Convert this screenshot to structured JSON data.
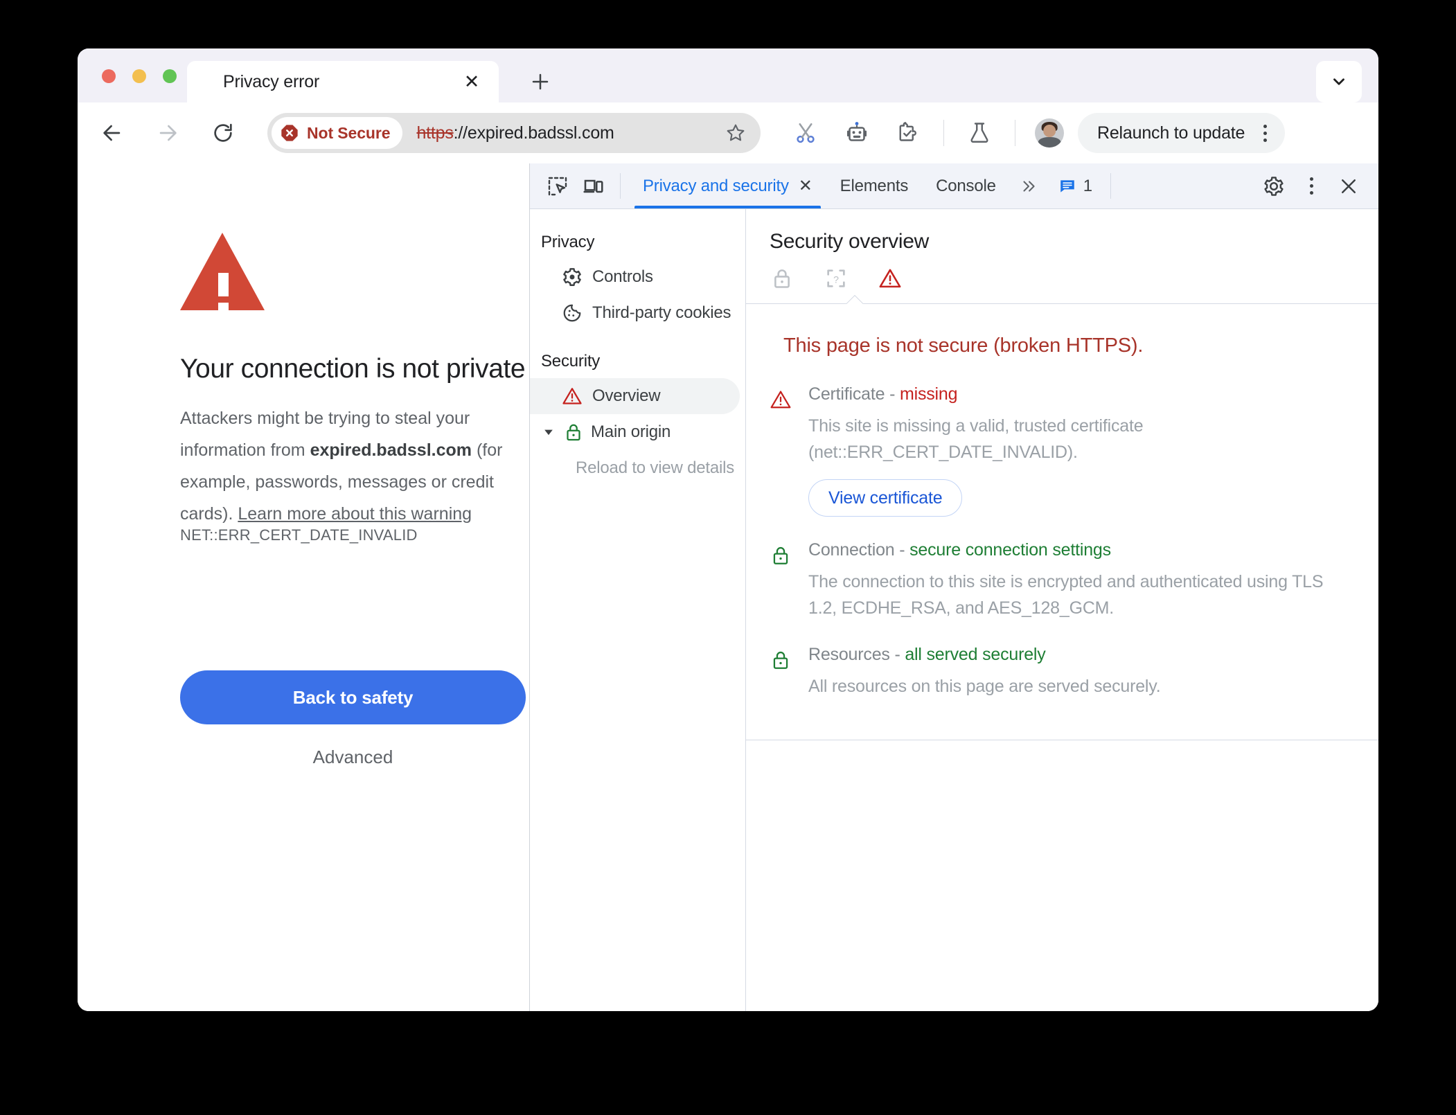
{
  "window": {
    "chevron_icon": "chevron-down-icon"
  },
  "tabstrip": {
    "tab_title": "Privacy error",
    "close_icon": "close-icon",
    "new_tab_icon": "plus-icon"
  },
  "toolbar": {
    "back_icon": "arrow-left-icon",
    "forward_icon": "arrow-right-icon",
    "reload_icon": "reload-icon",
    "security_badge": "Not Secure",
    "security_badge_icon": "not-secure-octagon-icon",
    "url_scheme": "https",
    "url_rest": "://expired.badssl.com",
    "bookmark_icon": "star-icon",
    "extension_icons": [
      "scissors-icon",
      "robot-icon",
      "puzzle-extension-icon",
      "flask-experiments-icon"
    ],
    "avatar_icon": "profile-avatar",
    "relaunch_label": "Relaunch to update",
    "menu_icon": "kebab-menu-icon"
  },
  "page": {
    "warning_icon": "warning-triangle-icon",
    "heading": "Your connection is not private",
    "body_before": "Attackers might be trying to steal your information from ",
    "body_host": "expired.badssl.com",
    "body_after": " (for example, passwords, messages or credit cards). ",
    "body_link": "Learn more about this warning",
    "error_code": "NET::ERR_CERT_DATE_INVALID",
    "back_to_safety_label": "Back to safety",
    "advanced_label": "Advanced"
  },
  "devtools": {
    "inspect_icon": "inspect-element-icon",
    "device_icon": "device-toolbar-icon",
    "tabs": [
      {
        "label": "Privacy and security",
        "active": true,
        "closable": true
      },
      {
        "label": "Elements",
        "active": false,
        "closable": false
      },
      {
        "label": "Console",
        "active": false,
        "closable": false
      }
    ],
    "more_tabs_icon": "chevrons-right-icon",
    "issues_icon": "issues-message-icon",
    "issues_count": "1",
    "settings_icon": "gear-icon",
    "menu_icon": "kebab-menu-icon",
    "close_icon": "close-icon",
    "sidebar": {
      "groups": [
        {
          "title": "Privacy",
          "items": [
            {
              "label": "Controls",
              "icon": "gear-icon",
              "selected": false
            },
            {
              "label": "Third-party cookies",
              "icon": "cookie-icon",
              "selected": false
            }
          ]
        },
        {
          "title": "Security",
          "items": [
            {
              "label": "Overview",
              "icon": "warning-triangle-icon",
              "selected": true
            },
            {
              "label": "Main origin",
              "icon": "lock-green-icon",
              "selected": false,
              "expandable": true
            }
          ]
        }
      ],
      "sub_note": "Reload to view details"
    },
    "overview": {
      "title": "Security overview",
      "states": [
        {
          "icon": "lock-gray-icon",
          "active": false
        },
        {
          "icon": "unknown-question-icon",
          "active": false
        },
        {
          "icon": "warning-triangle-red-icon",
          "active": true
        }
      ],
      "summary": "This page is not secure (broken HTTPS).",
      "rows": [
        {
          "icon": "warning-triangle-red-icon",
          "label": "Certificate",
          "value": "missing",
          "value_tone": "red",
          "description": "This site is missing a valid, trusted certificate (net::ERR_CERT_DATE_INVALID).",
          "button": "View certificate"
        },
        {
          "icon": "lock-green-icon",
          "label": "Connection",
          "value": "secure connection settings",
          "value_tone": "green",
          "description": "The connection to this site is encrypted and authenticated using TLS 1.2, ECDHE_RSA, and AES_128_GCM.",
          "button": null
        },
        {
          "icon": "lock-green-icon",
          "label": "Resources",
          "value": "all served securely",
          "value_tone": "green",
          "description": "All resources on this page are served securely.",
          "button": null
        }
      ]
    }
  },
  "colors": {
    "accent_blue": "#1a73e8",
    "button_blue": "#3b71e8",
    "danger_red": "#a8342a",
    "warning_red": "#d14836",
    "secure_green": "#1e7e34"
  }
}
